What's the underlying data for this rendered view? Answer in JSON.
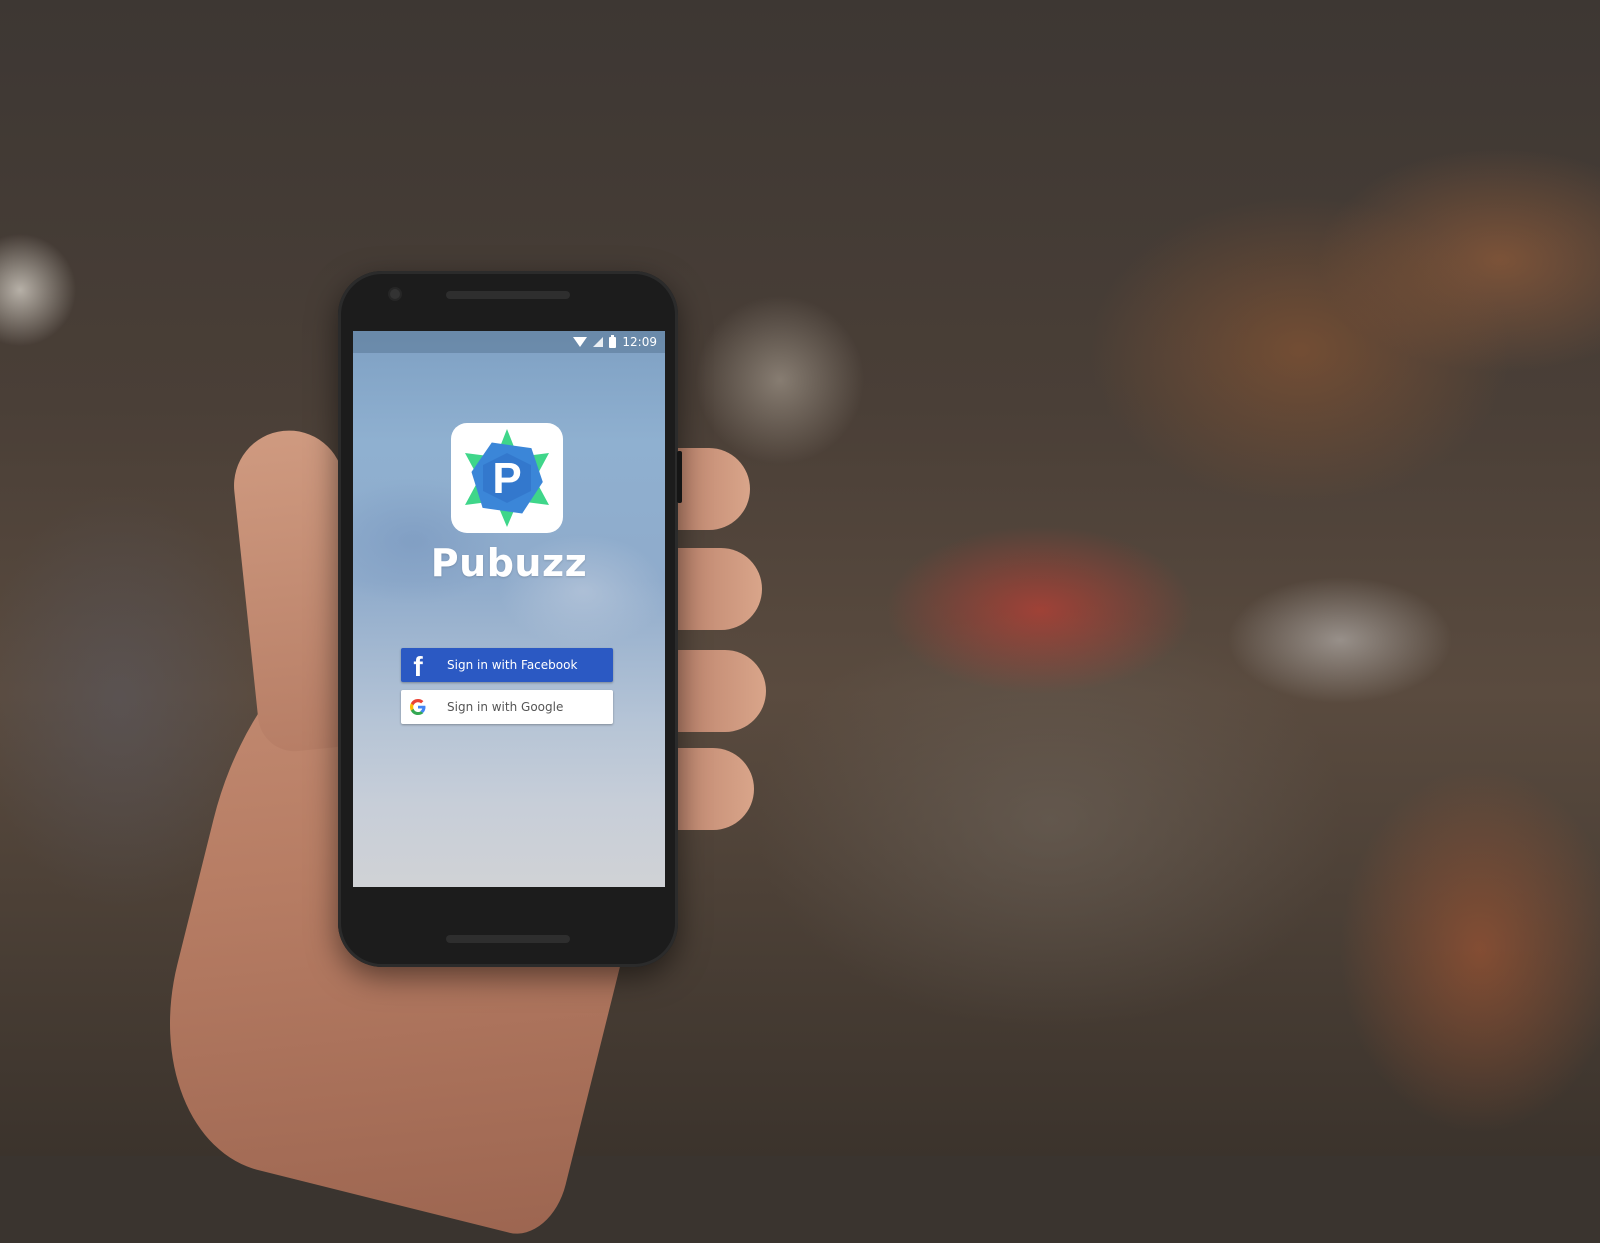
{
  "status_bar": {
    "time": "12:09",
    "icons": [
      "wifi-icon",
      "signal-icon",
      "battery-icon"
    ]
  },
  "app": {
    "name": "Pubuzz",
    "logo_letter": "P"
  },
  "buttons": {
    "facebook": {
      "label": "Sign in with Facebook",
      "icon": "facebook-icon"
    },
    "google": {
      "label": "Sign in with Google",
      "icon": "google-icon"
    }
  },
  "colors": {
    "facebook_blue": "#2b59c3",
    "logo_blue": "#3b86d8",
    "logo_green": "#3fd68a"
  }
}
